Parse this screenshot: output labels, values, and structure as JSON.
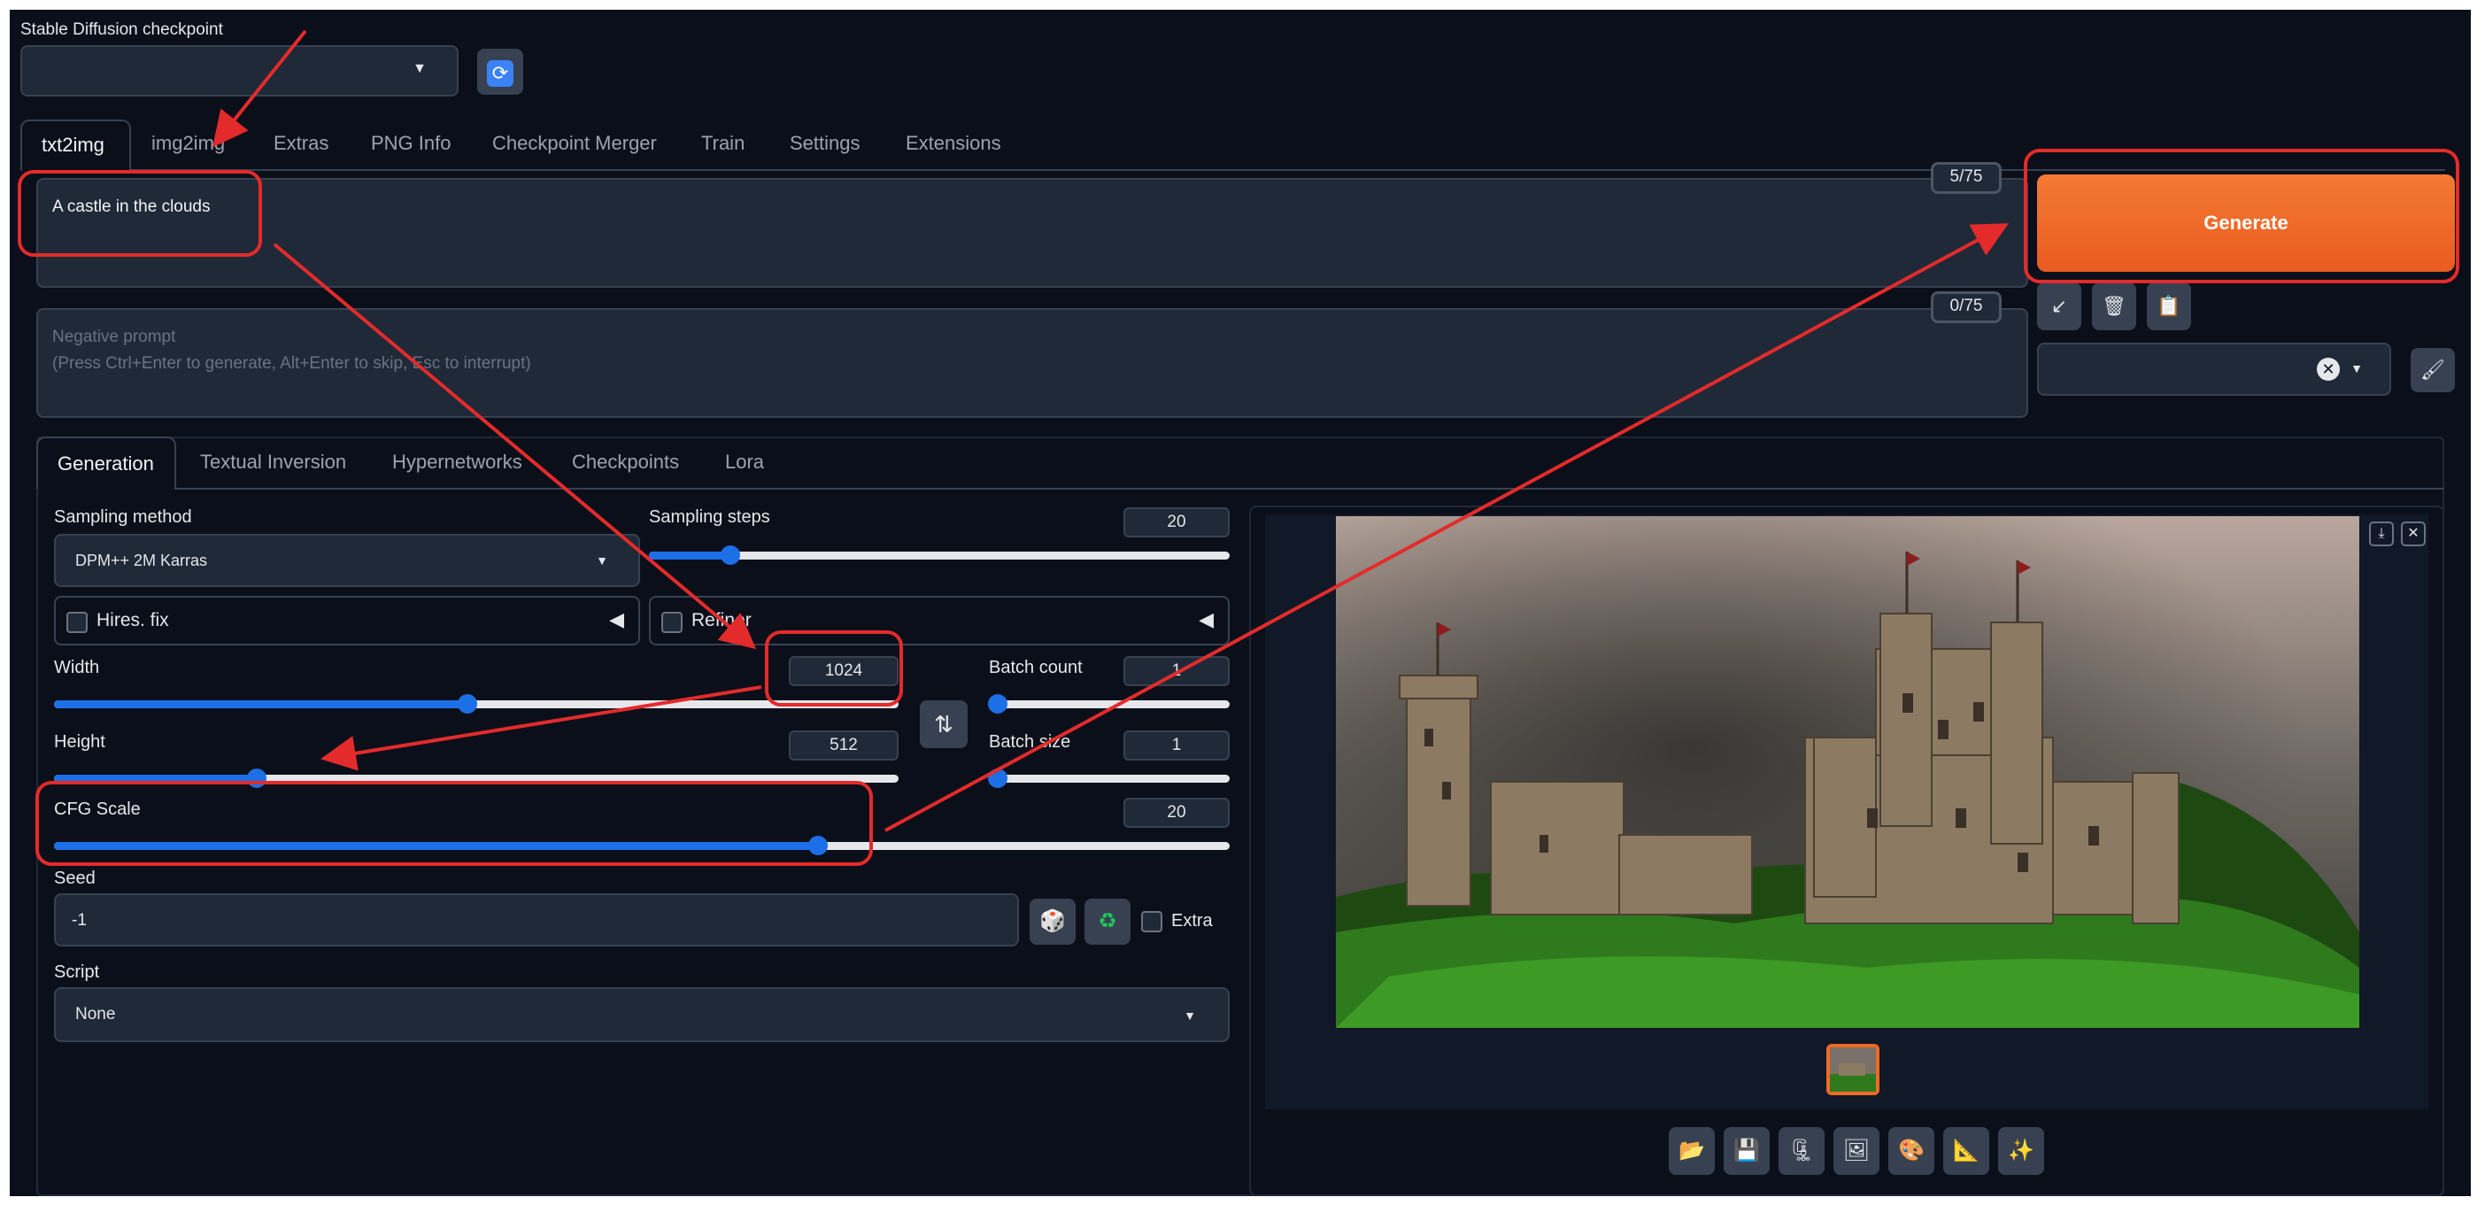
{
  "checkpoint": {
    "label": "Stable Diffusion checkpoint",
    "value": ""
  },
  "main_tabs": [
    "txt2img",
    "img2img",
    "Extras",
    "PNG Info",
    "Checkpoint Merger",
    "Train",
    "Settings",
    "Extensions"
  ],
  "prompt": {
    "value": "A castle in the clouds",
    "counter": "5/75"
  },
  "negative_prompt": {
    "placeholder_line1": "Negative prompt",
    "placeholder_line2": "(Press Ctrl+Enter to generate, Alt+Enter to skip, Esc to interrupt)",
    "counter": "0/75"
  },
  "generate_label": "Generate",
  "sub_tabs": [
    "Generation",
    "Textual Inversion",
    "Hypernetworks",
    "Checkpoints",
    "Lora"
  ],
  "sampling_method": {
    "label": "Sampling method",
    "value": "DPM++ 2M Karras"
  },
  "sampling_steps": {
    "label": "Sampling steps",
    "value": "20",
    "fraction": 0.14
  },
  "hires_fix": {
    "label": "Hires. fix",
    "checked": false
  },
  "refiner": {
    "label": "Refiner",
    "checked": false
  },
  "width": {
    "label": "Width",
    "value": "1024",
    "fraction": 0.49
  },
  "height": {
    "label": "Height",
    "value": "512",
    "fraction": 0.24
  },
  "batch_count": {
    "label": "Batch count",
    "value": "1",
    "fraction": 0.0
  },
  "batch_size": {
    "label": "Batch size",
    "value": "1",
    "fraction": 0.0
  },
  "cfg_scale": {
    "label": "CFG Scale",
    "value": "20",
    "fraction": 0.65
  },
  "seed": {
    "label": "Seed",
    "value": "-1",
    "extra_label": "Extra"
  },
  "script": {
    "label": "Script",
    "value": "None"
  },
  "colors": {
    "accent": "#f06a26",
    "slider": "#1d6fe8",
    "annotation": "#e32b2b",
    "background": "#0b0f19"
  },
  "icons": {
    "refresh": "refresh-icon",
    "swap": "swap-dimensions-icon",
    "dice": "dice-icon",
    "recycle": "recycle-icon",
    "read_params": "arrow-down-left-icon",
    "trash": "trash-icon",
    "clipboard": "clipboard-icon",
    "brush": "brush-icon",
    "folder": "folder-icon",
    "save": "save-icon",
    "zip": "zip-icon",
    "image": "image-icon",
    "palette": "palette-icon",
    "ruler": "ruler-icon",
    "sparkles": "sparkles-icon"
  }
}
